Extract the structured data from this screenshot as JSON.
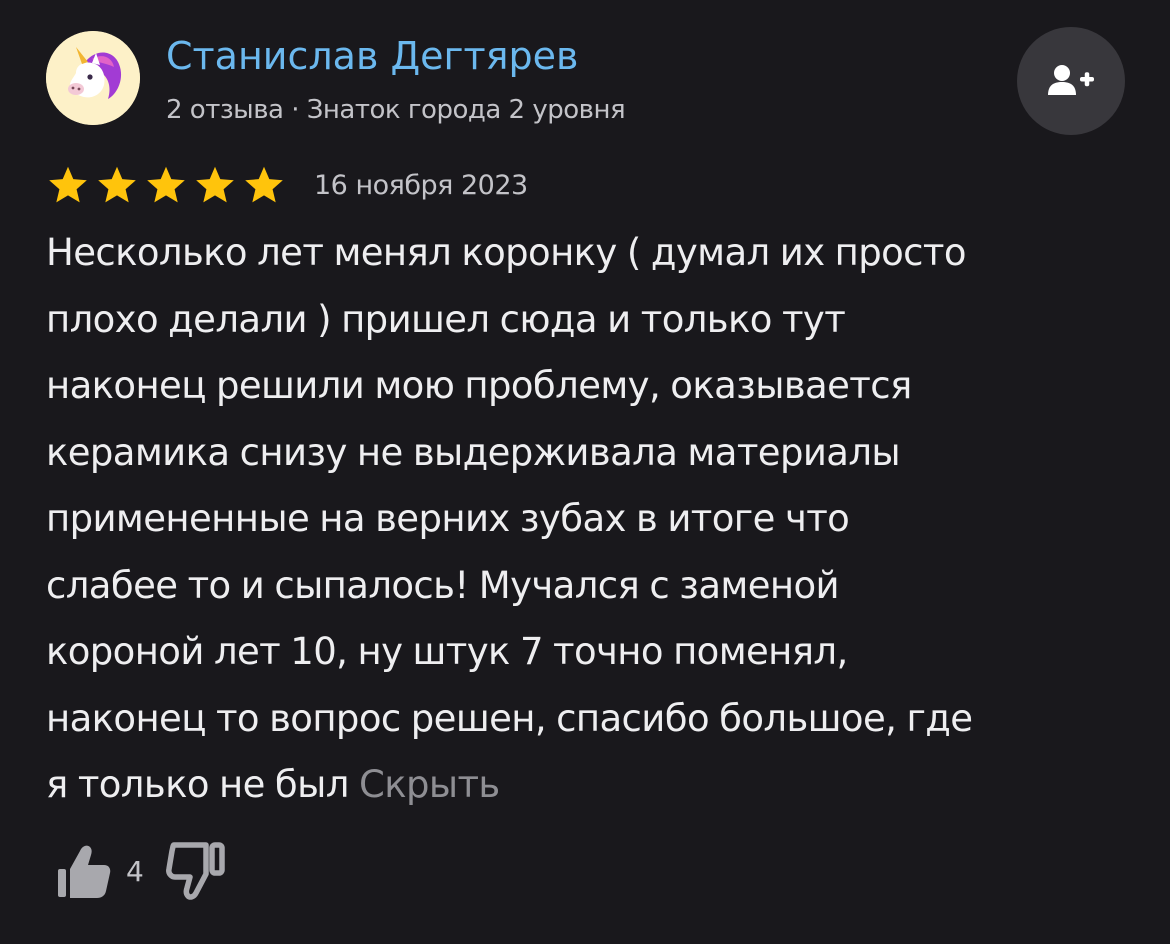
{
  "author": {
    "name": "Станислав Дегтярев",
    "meta": "2 отзыва · Знаток города 2 уровня",
    "avatar_icon": "unicorn-avatar-icon"
  },
  "actions": {
    "subscribe_icon": "add-user-icon"
  },
  "review": {
    "rating": 5,
    "rating_max": 5,
    "date": "16 ноября 2023",
    "text_lines": [
      "Несколько лет менял коронку ( думал их просто",
      "плохо делали ) пришел сюда и только тут",
      "наконец решили мою проблему, оказывается",
      "керамика снизу не выдерживала материалы",
      "примененные на верних зубах в итоге что",
      "слабее то и сыпалось! Мучался с заменой",
      "короной лет 10, ну штук 7 точно поменял,",
      "наконец то вопрос решен, спасибо большое, где",
      "я только не был"
    ],
    "hide_label": "Скрыть"
  },
  "reactions": {
    "like_count": "4",
    "like_icon": "thumbs-up-icon",
    "dislike_icon": "thumbs-down-icon"
  },
  "colors": {
    "background": "#19181c",
    "author_name": "#6bb8ee",
    "star": "#ffc40c",
    "secondary_text": "#c3c3c8",
    "link_muted": "#8e8e93",
    "button_bg": "#38373c"
  }
}
